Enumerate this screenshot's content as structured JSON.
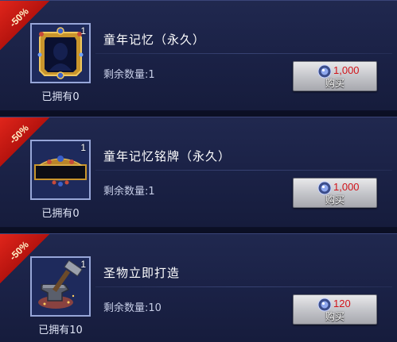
{
  "shop": {
    "items": [
      {
        "discount": "-50%",
        "name": "童年记忆（永久）",
        "count": "1",
        "owned": "已拥有0",
        "remain": "剩余数量:1",
        "price": "1,000",
        "buy_label": "购买",
        "icon": "portrait-frame-icon"
      },
      {
        "discount": "-50%",
        "name": "童年记忆铭牌（永久）",
        "count": "1",
        "owned": "已拥有0",
        "remain": "剩余数量:1",
        "price": "1,000",
        "buy_label": "购买",
        "icon": "nameplate-icon"
      },
      {
        "discount": "-50%",
        "name": "圣物立即打造",
        "count": "1",
        "owned": "已拥有10",
        "remain": "剩余数量:10",
        "price": "120",
        "buy_label": "购买",
        "icon": "anvil-hammer-icon"
      }
    ]
  },
  "colors": {
    "card_bg": "#1d2449",
    "discount_ribbon": "#d01d15",
    "price_red": "#d1141a",
    "button_grey": "#c2c3c8"
  }
}
